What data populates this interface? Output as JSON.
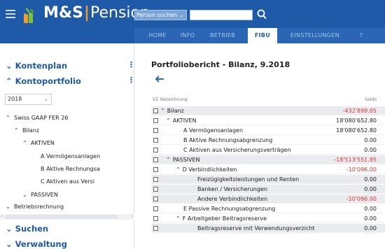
{
  "brand": {
    "ms": "M&S",
    "sep": "|",
    "product": "Pension"
  },
  "search": {
    "select_label": "Person suchen",
    "value": ""
  },
  "nav": {
    "tabs": [
      {
        "label": "HOME",
        "active": false
      },
      {
        "label": "INFO",
        "active": false
      },
      {
        "label": "BETRIEB",
        "active": false
      },
      {
        "label": "FIBU",
        "active": true
      },
      {
        "label": "EINSTELLUNGEN",
        "active": false
      },
      {
        "label": "?",
        "active": false
      }
    ]
  },
  "sidebar": {
    "kontenplan": "Kontenplan",
    "kontoportfolio": "Kontoportfolio",
    "year": "2018",
    "tree": [
      "Swiss GAAP FER 26",
      "Bilanz",
      "AKTIVEN",
      "A Vermögensanlagen",
      "B Aktive Rechnungsa",
      "C Aktiven aus Versi",
      "PASSIVEN",
      "Betriebsrechnung"
    ],
    "suchen": "Suchen",
    "verwaltung": "Verwaltung"
  },
  "main": {
    "title": "Portfoliobericht - Bilanz, 9.2018",
    "col_vz": "VZ",
    "col_bez": "Bezeichnung",
    "col_saldo": "Saldo",
    "rows": [
      {
        "label": "Bilanz",
        "value": "-432'899.05"
      },
      {
        "label": "AKTIVEN",
        "value": "18'080'652.80"
      },
      {
        "label": "A Vermögensanlagen",
        "value": "18'080'652.80"
      },
      {
        "label": "B Aktive Rechnungsabgrenzung",
        "value": "0.00"
      },
      {
        "label": "C Aktiven aus Versicherungsverträgen",
        "value": "0.00"
      },
      {
        "label": "PASSIVEN",
        "value": "-18'513'551.85"
      },
      {
        "label": "D Verbindlichkeiten",
        "value": "-10'096.00"
      },
      {
        "label": "Freizügigkeitsleistungen und Renten",
        "value": "0.00"
      },
      {
        "label": "Banken / Versicherungen",
        "value": "0.00"
      },
      {
        "label": "Andere Verbindlichkeiten",
        "value": "-10'096.00"
      },
      {
        "label": "E Passive Rechnungsabgrenzung",
        "value": "0.00"
      },
      {
        "label": "F Arbeitgeber Beitragsreserve",
        "value": "0.00"
      },
      {
        "label": "Beitragsreserve mit Verwendungsverzicht",
        "value": "0.00"
      }
    ]
  },
  "colors": {
    "brand_blue": "#1e5aa8",
    "accent_orange": "#f19a33",
    "negative_red": "#e0312b"
  }
}
